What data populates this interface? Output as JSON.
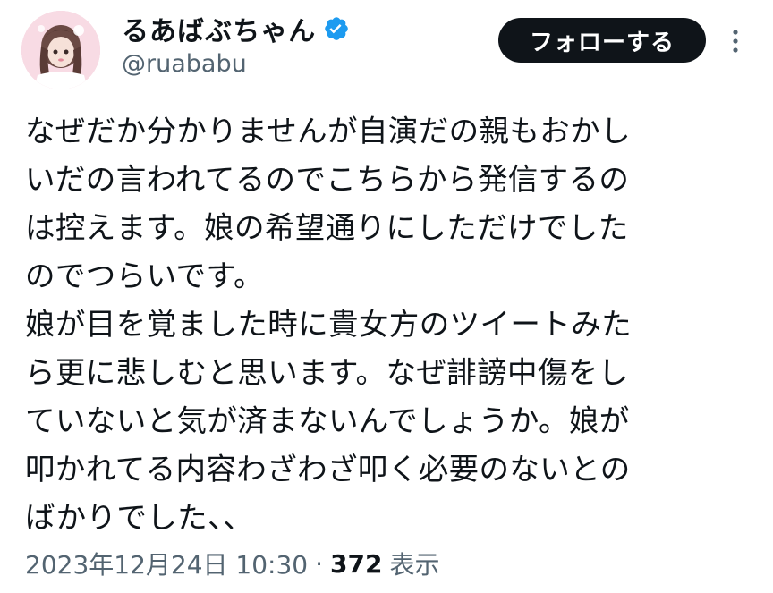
{
  "author": {
    "display_name": "るあばぶちゃん",
    "handle": "@ruababu",
    "verified": true,
    "verified_color": "#1d9bf0"
  },
  "actions": {
    "follow_label": "フォローする",
    "more_icon": "more-dots-icon"
  },
  "tweet": {
    "lines": [
      "なぜだか分かりませんが自演だの親もおかし",
      "いだの言われてるのでこちらから発信するの",
      "は控えます。娘の希望通りにしただけでした",
      "のでつらいです。",
      "娘が目を覚ました時に貴女方のツイートみた",
      "ら更に悲しむと思います。なぜ誹謗中傷をし",
      "ていないと気が済まないんでしょうか。娘が",
      "叩かれてる内容わざわざ叩く必要のないとの",
      "ばかりでした、、"
    ]
  },
  "meta": {
    "timestamp": "2023年12月24日 10:30",
    "separator": "·",
    "views_count": "372",
    "views_label": "表示"
  }
}
